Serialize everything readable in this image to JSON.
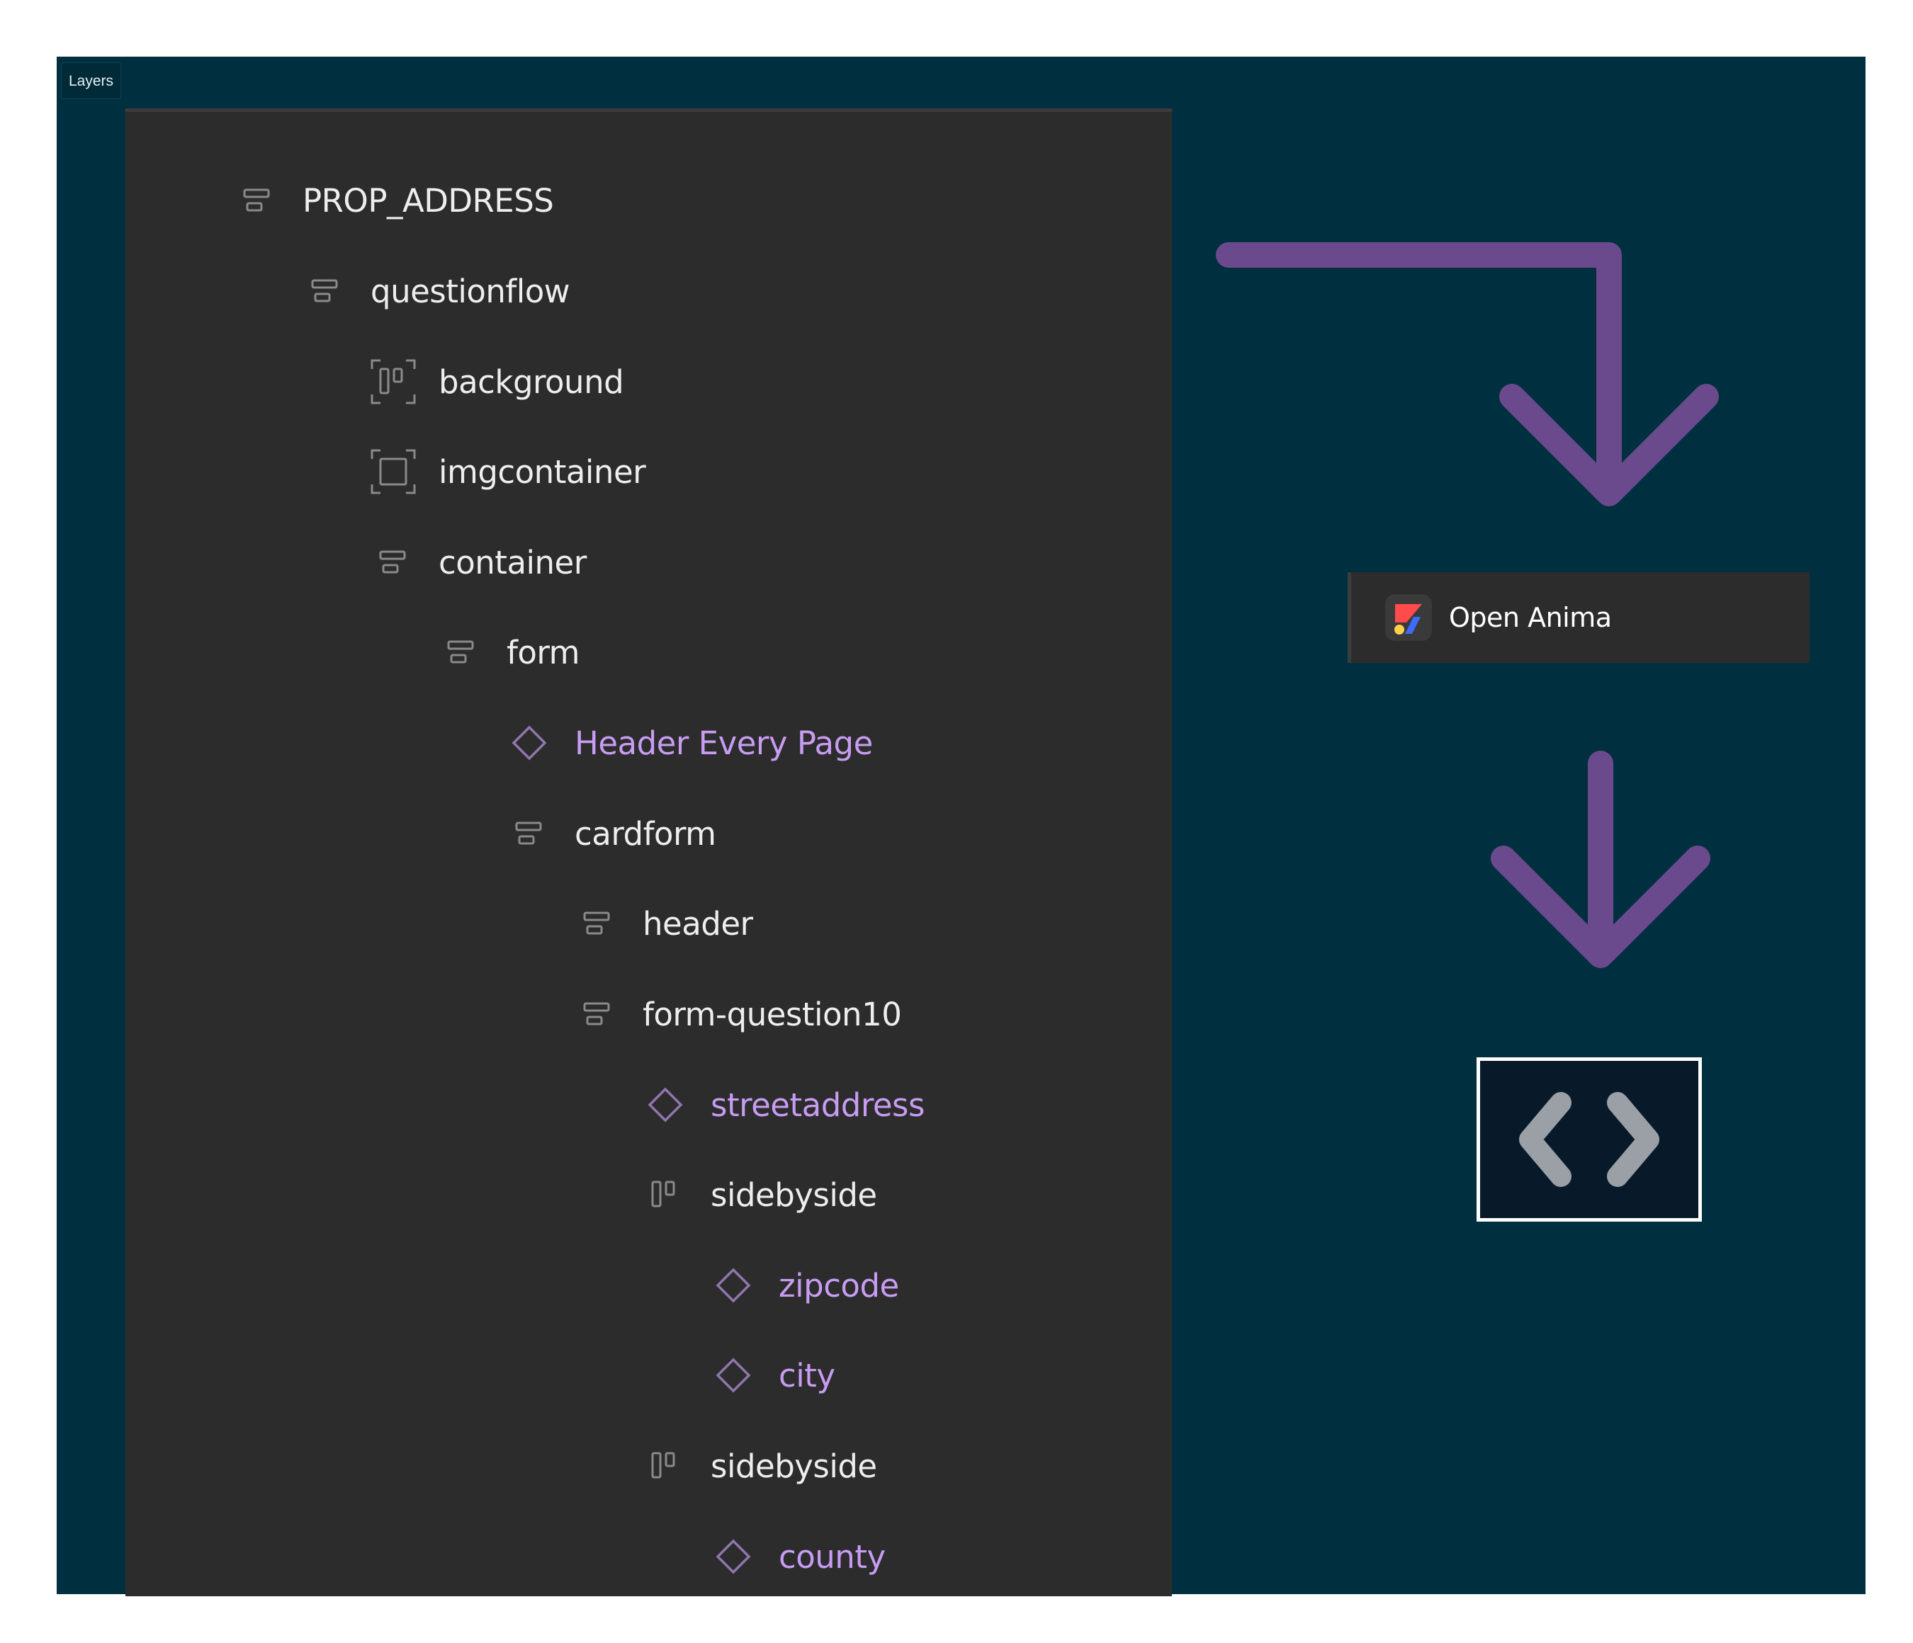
{
  "panel": {
    "tab_label": "Layers"
  },
  "layers": [
    {
      "label": "PROP_ADDRESS",
      "icon": "frame-autolayout-vertical-icon",
      "depth": 0,
      "kind": "frame"
    },
    {
      "label": "questionflow",
      "icon": "frame-autolayout-vertical-icon",
      "depth": 1,
      "kind": "frame"
    },
    {
      "label": "background",
      "icon": "frame-autolayout-horizontal-icon",
      "depth": 2,
      "kind": "frame"
    },
    {
      "label": "imgcontainer",
      "icon": "frame-icon",
      "depth": 2,
      "kind": "frame"
    },
    {
      "label": "container",
      "icon": "autolayout-vertical-icon",
      "depth": 2,
      "kind": "group"
    },
    {
      "label": "form",
      "icon": "autolayout-vertical-icon",
      "depth": 3,
      "kind": "group"
    },
    {
      "label": "Header Every Page",
      "icon": "component-instance-icon",
      "depth": 4,
      "kind": "component"
    },
    {
      "label": "cardform",
      "icon": "autolayout-vertical-icon",
      "depth": 4,
      "kind": "group"
    },
    {
      "label": "header",
      "icon": "autolayout-vertical-icon",
      "depth": 5,
      "kind": "group"
    },
    {
      "label": "form-question10",
      "icon": "autolayout-vertical-icon",
      "depth": 5,
      "kind": "group"
    },
    {
      "label": "streetaddress",
      "icon": "component-instance-icon",
      "depth": 6,
      "kind": "component"
    },
    {
      "label": "sidebyside",
      "icon": "autolayout-horizontal-icon",
      "depth": 6,
      "kind": "group"
    },
    {
      "label": "zipcode",
      "icon": "component-instance-icon",
      "depth": 7,
      "kind": "component"
    },
    {
      "label": "city",
      "icon": "component-instance-icon",
      "depth": 7,
      "kind": "component"
    },
    {
      "label": "sidebyside",
      "icon": "autolayout-horizontal-icon",
      "depth": 6,
      "kind": "group"
    },
    {
      "label": "county",
      "icon": "component-instance-icon",
      "depth": 7,
      "kind": "component"
    }
  ],
  "plugin": {
    "button_label": "Open Anima",
    "icon": "anima-logo-icon"
  },
  "output": {
    "icon": "code-brackets-icon"
  },
  "colors": {
    "background": "#00303f",
    "panel": "#2c2c2c",
    "text": "#eeeeee",
    "component_text": "#c79cf2",
    "arrow": "#6a4a8c"
  }
}
